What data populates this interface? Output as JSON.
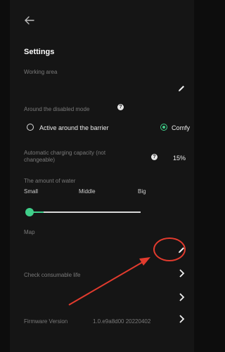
{
  "header": {
    "back_icon": "arrow-left-icon",
    "title": "Settings"
  },
  "working_area": {
    "label": "Working area",
    "edit_icon": "pencil-icon"
  },
  "disabled_mode": {
    "label": "Around the disabled mode",
    "help_icon": "question-icon",
    "options": [
      {
        "label": "Active around the barrier",
        "selected": false
      },
      {
        "label": "Comfy",
        "selected": true
      }
    ]
  },
  "charging": {
    "label": "Automatic charging capacity (not changeable)",
    "help_icon": "question-icon",
    "value": "15%"
  },
  "water": {
    "label": "The amount of water",
    "levels": [
      "Small",
      "Middle",
      "Big"
    ],
    "selected": "Small"
  },
  "map": {
    "label": "Map",
    "edit_icon": "pencil-icon"
  },
  "consumables": {
    "label": "Check consumable life",
    "chevron_icon": "chevron-right-icon"
  },
  "empty_row": {
    "chevron_icon": "chevron-right-icon"
  },
  "firmware": {
    "label": "Firmware Version",
    "value": "1.0.e9a8d00 20220402",
    "chevron_icon": "chevron-right-icon"
  },
  "annotation": {
    "color": "#e23b2e"
  },
  "accent": "#3fcf8a"
}
